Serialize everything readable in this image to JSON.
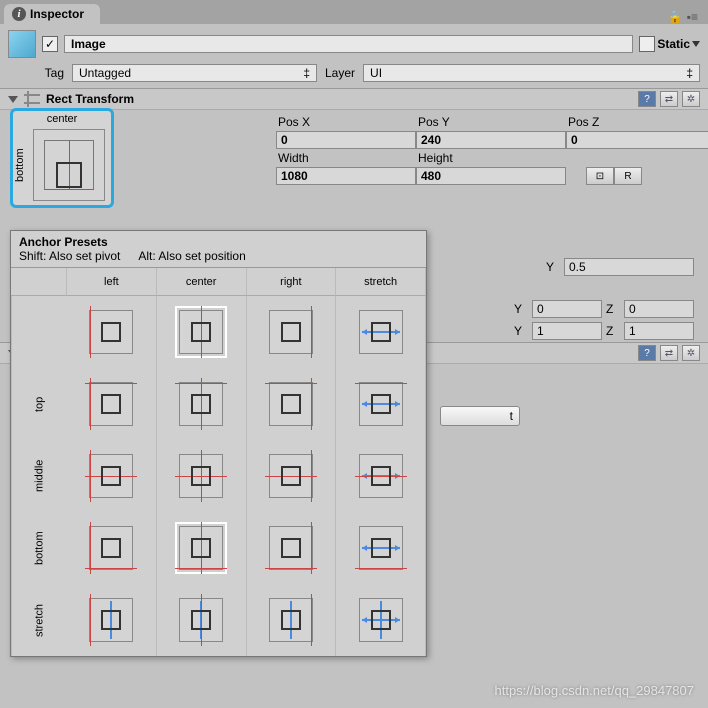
{
  "tab": {
    "title": "Inspector"
  },
  "header": {
    "name": "Image",
    "active_checked": "✓",
    "static_label": "Static",
    "tag_label": "Tag",
    "tag_value": "Untagged",
    "layer_label": "Layer",
    "layer_value": "UI"
  },
  "rect_transform": {
    "title": "Rect Transform",
    "anchor_col": "center",
    "anchor_row": "bottom",
    "labels": {
      "posx": "Pos X",
      "posy": "Pos Y",
      "posz": "Pos Z",
      "width": "Width",
      "height": "Height"
    },
    "values": {
      "posx": "0",
      "posy": "240",
      "posz": "0",
      "width": "1080",
      "height": "480"
    },
    "blueprint_btn": "⊡",
    "raw_btn": "R"
  },
  "pivot": {
    "y_lbl": "Y",
    "y": "0.5"
  },
  "rotation": {
    "y_lbl": "Y",
    "y": "0",
    "z_lbl": "Z",
    "z": "0"
  },
  "scale": {
    "y_lbl": "Y",
    "y": "1",
    "z_lbl": "Z",
    "z": "1"
  },
  "popup": {
    "title": "Anchor Presets",
    "hint_shift": "Shift: Also set pivot",
    "hint_alt": "Alt: Also set position",
    "cols": [
      "left",
      "center",
      "right",
      "stretch"
    ],
    "rows": [
      "top",
      "middle",
      "bottom",
      "stretch"
    ]
  },
  "sprite_btn_label": "t",
  "watermark": "https://blog.csdn.net/qq_29847807"
}
